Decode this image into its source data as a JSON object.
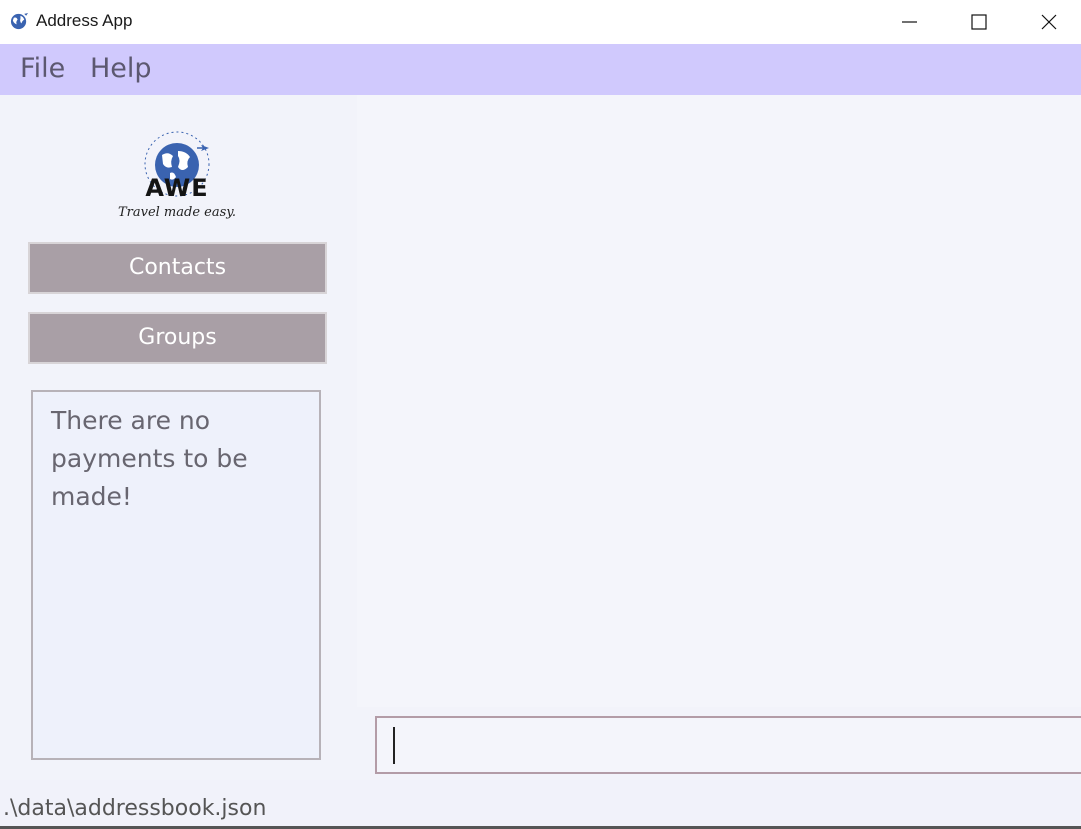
{
  "window": {
    "title": "Address App"
  },
  "menu": {
    "file_label": "File",
    "help_label": "Help"
  },
  "logo": {
    "word": "AWE",
    "tagline": "Travel made easy."
  },
  "sidebar": {
    "contacts_label": "Contacts",
    "groups_label": "Groups",
    "payments_message": "There are no payments to be made!"
  },
  "command": {
    "value": "",
    "placeholder": ""
  },
  "status": {
    "file_path": ".\\data\\addressbook.json"
  },
  "colors": {
    "menubar": "#d0c9fd",
    "nav_button": "#a99fa6",
    "background": "#f2f3fa",
    "globe": "#3a63b0"
  }
}
